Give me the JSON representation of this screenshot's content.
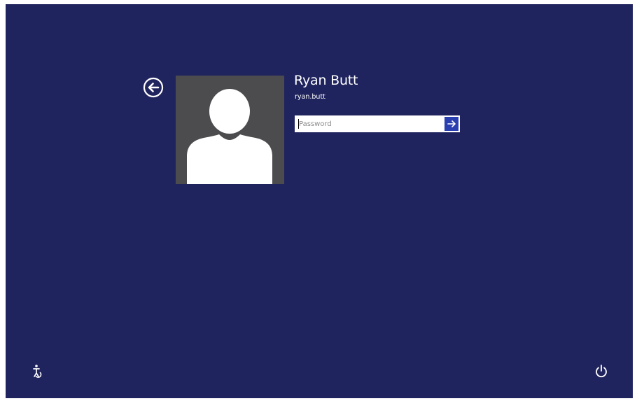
{
  "user": {
    "display_name": "Ryan Butt",
    "login": "ryan.butt"
  },
  "password": {
    "placeholder": "Password",
    "value": ""
  },
  "icons": {
    "back": "back-arrow-circle-icon",
    "submit": "right-arrow-icon",
    "avatar": "user-silhouette-icon",
    "ease_of_access": "ease-of-access-icon",
    "power": "power-icon"
  },
  "colors": {
    "background": "#20245e",
    "avatar_tile": "#4c4c4e",
    "submit_button": "#2a3fb0",
    "text": "#ffffff"
  }
}
